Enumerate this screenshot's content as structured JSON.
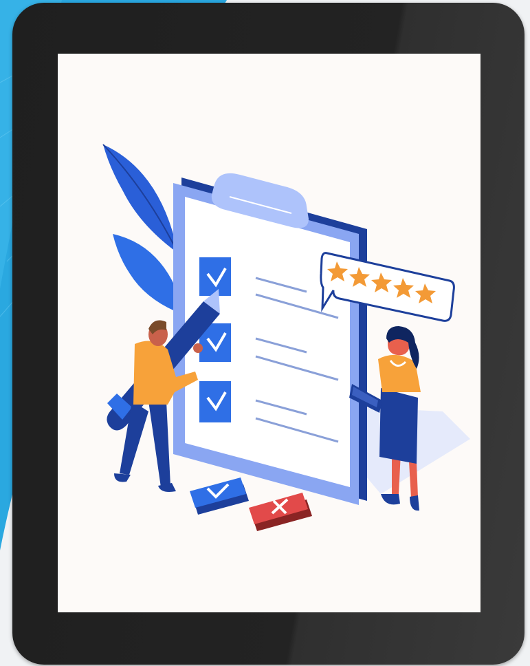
{
  "image": {
    "subject": "tablet-displaying-checklist-illustration",
    "rating_stars": 5,
    "checked_items": 3,
    "buttons": [
      "check-icon",
      "cross-icon"
    ],
    "colors": {
      "background_blue": "#2aa8e0",
      "tablet_frame": "#222222",
      "screen": "#fdfaf8",
      "clipboard_dark": "#1d3f9b",
      "clipboard_mid": "#8aa6f2",
      "checkbox_blue": "#2f6fe6",
      "star_orange": "#f39a36",
      "shirt_orange": "#f7a23a",
      "reject_red": "#e24a4a"
    }
  }
}
